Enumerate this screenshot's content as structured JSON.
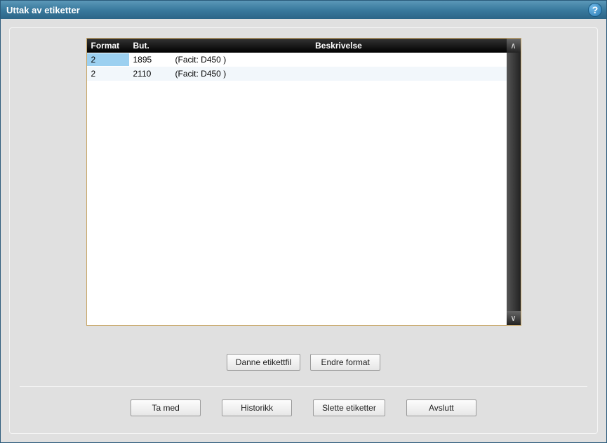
{
  "window": {
    "title": "Uttak av etiketter"
  },
  "help": {
    "symbol": "?"
  },
  "table": {
    "headers": {
      "format": "Format",
      "but": "But.",
      "beskrivelse": "Beskrivelse"
    },
    "rows": [
      {
        "format": "2",
        "but": "1895",
        "beskrivelse": "(Facit: D450   )",
        "selected": true
      },
      {
        "format": "2",
        "but": "2110",
        "beskrivelse": "(Facit: D450   )",
        "selected": false
      }
    ]
  },
  "scroll": {
    "up": "∧",
    "down": "∨"
  },
  "buttons": {
    "danne": "Danne etikettfil",
    "endre": "Endre format",
    "tamed": "Ta med",
    "historikk": "Historikk",
    "slette": "Slette etiketter",
    "avslutt": "Avslutt"
  }
}
